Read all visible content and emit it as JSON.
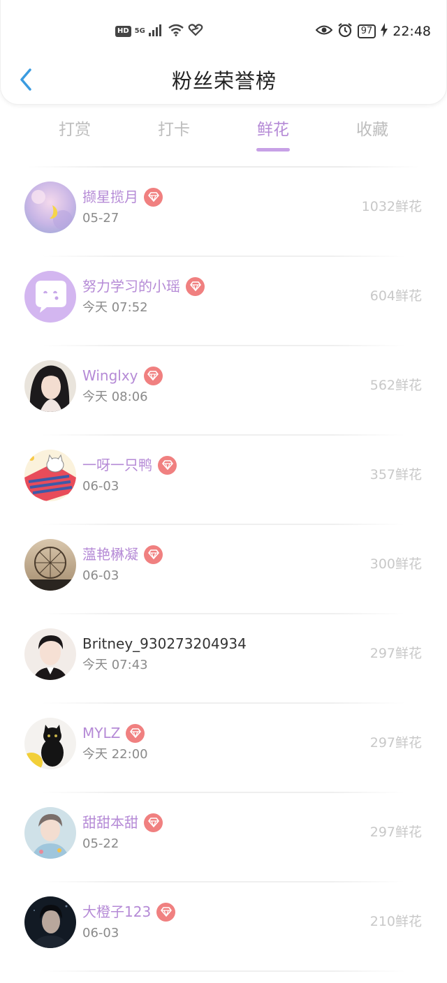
{
  "status_bar": {
    "hd": "HD",
    "network": "5G",
    "battery": "97",
    "time": "22:48",
    "icons": [
      "signal-icon",
      "wifi-icon",
      "heart-link-icon",
      "eye-icon",
      "alarm-icon",
      "charging-icon"
    ]
  },
  "header": {
    "title": "粉丝荣誉榜",
    "back_icon": "chevron-left-icon"
  },
  "tabs": [
    {
      "label": "打赏",
      "active": false
    },
    {
      "label": "打卡",
      "active": false
    },
    {
      "label": "鲜花",
      "active": true
    },
    {
      "label": "收藏",
      "active": false
    }
  ],
  "colors": {
    "accent": "#b58ad6",
    "badge": "#f08080",
    "back_icon": "#3a9be0",
    "muted_text": "#c8c8c8"
  },
  "ranking": [
    {
      "name": "撷星揽月",
      "date": "05-27",
      "flowers": "1032鲜花",
      "vip": true,
      "avatar": "dreamy-moon-avatar"
    },
    {
      "name": "努力学习的小瑶",
      "date": "今天 07:52",
      "flowers": "604鲜花",
      "vip": true,
      "avatar": "default-chat-avatar"
    },
    {
      "name": "Winglxy",
      "date": "今天 08:06",
      "flowers": "562鲜花",
      "vip": true,
      "avatar": "woman-portrait-avatar"
    },
    {
      "name": "一呀一只鸭",
      "date": "06-03",
      "flowers": "357鲜花",
      "vip": true,
      "avatar": "cartoon-cat-avatar"
    },
    {
      "name": "薀艳楙凝",
      "date": "06-03",
      "flowers": "300鲜花",
      "vip": true,
      "avatar": "ferris-wheel-avatar"
    },
    {
      "name": "Britney_930273204934",
      "date": "今天 07:43",
      "flowers": "297鲜花",
      "vip": false,
      "avatar": "man-portrait-avatar"
    },
    {
      "name": "MYLZ",
      "date": "今天 22:00",
      "flowers": "297鲜花",
      "vip": true,
      "avatar": "black-cat-avatar"
    },
    {
      "name": "甜甜本甜",
      "date": "05-22",
      "flowers": "297鲜花",
      "vip": true,
      "avatar": "boy-portrait-avatar"
    },
    {
      "name": "大橙子123",
      "date": "06-03",
      "flowers": "210鲜花",
      "vip": true,
      "avatar": "dark-portrait-avatar"
    }
  ]
}
